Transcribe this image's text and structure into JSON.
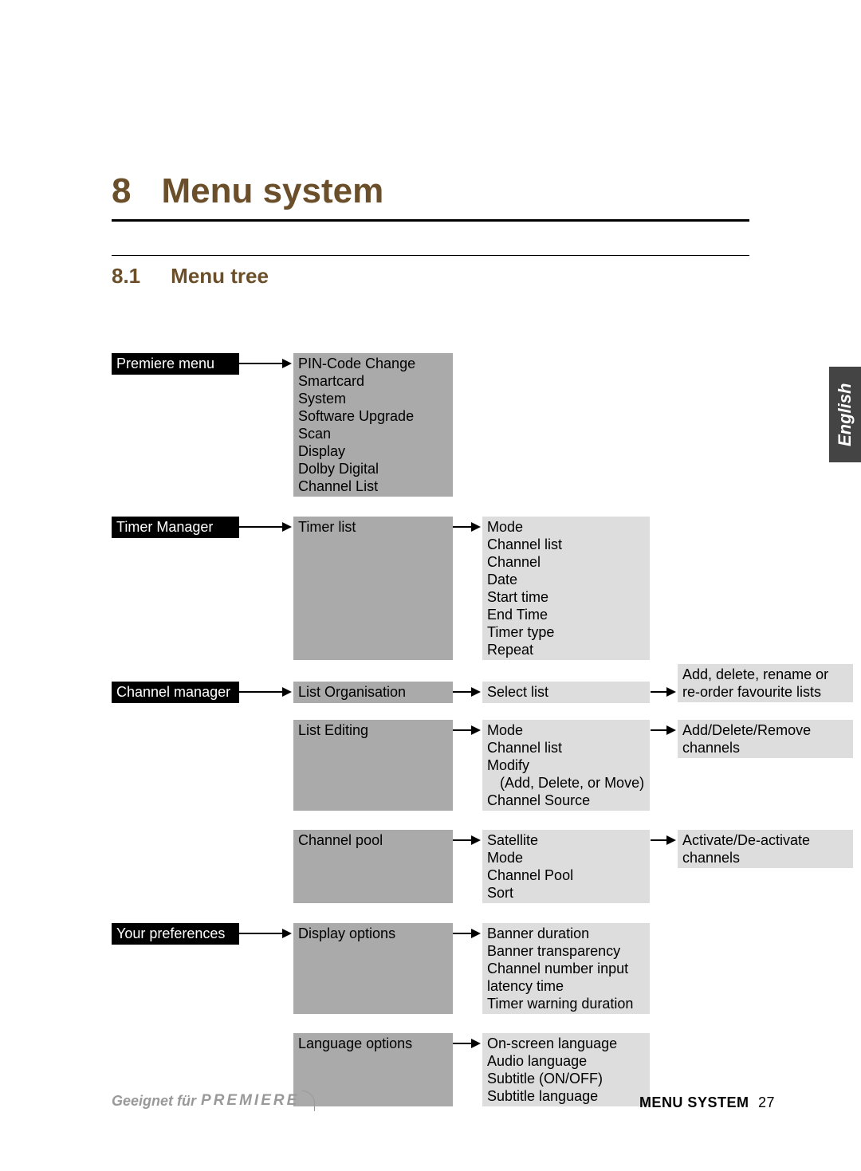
{
  "chapter": {
    "number": "8",
    "title": "Menu system"
  },
  "section": {
    "number": "8.1",
    "title": "Menu tree"
  },
  "sideTab": "English",
  "tree": {
    "premiere": {
      "label": "Premiere menu",
      "items": [
        "PIN-Code Change",
        "Smartcard",
        "System",
        "Software Upgrade",
        "Scan",
        "Display",
        "Dolby Digital",
        "Channel List"
      ]
    },
    "timer": {
      "label": "Timer Manager",
      "sub": {
        "label": "Timer list",
        "items": [
          "Mode",
          "Channel list",
          "Channel",
          "Date",
          "Start time",
          "End Time",
          "Timer type",
          "Repeat"
        ]
      }
    },
    "channel": {
      "label": "Channel manager",
      "org": {
        "label": "List Organisation",
        "sub": {
          "label": "Select list",
          "note": "Add, delete, rename or\nre-order favourite lists"
        }
      },
      "edit": {
        "label": "List Editing",
        "items": [
          "Mode",
          "Channel list",
          "Modify",
          " (Add, Delete, or Move)",
          "Channel Source"
        ],
        "note": "Add/Delete/Remove\nchannels"
      },
      "pool": {
        "label": "Channel pool",
        "items": [
          "Satellite",
          "Mode",
          "Channel Pool",
          "Sort"
        ],
        "note": "Activate/De-activate\nchannels"
      }
    },
    "pref": {
      "label": "Your preferences",
      "display": {
        "label": "Display options",
        "items": [
          "Banner duration",
          "Banner transparency",
          "Channel number input",
          "latency time",
          "Timer warning duration"
        ]
      },
      "lang": {
        "label": "Language options",
        "items": [
          "On-screen language",
          "Audio language",
          "Subtitle (ON/OFF)",
          "Subtitle language"
        ]
      }
    }
  },
  "footer": {
    "prefix": "Geeignet für",
    "brand": "PREMIERE",
    "section": "MENU SYSTEM",
    "page": "27"
  }
}
